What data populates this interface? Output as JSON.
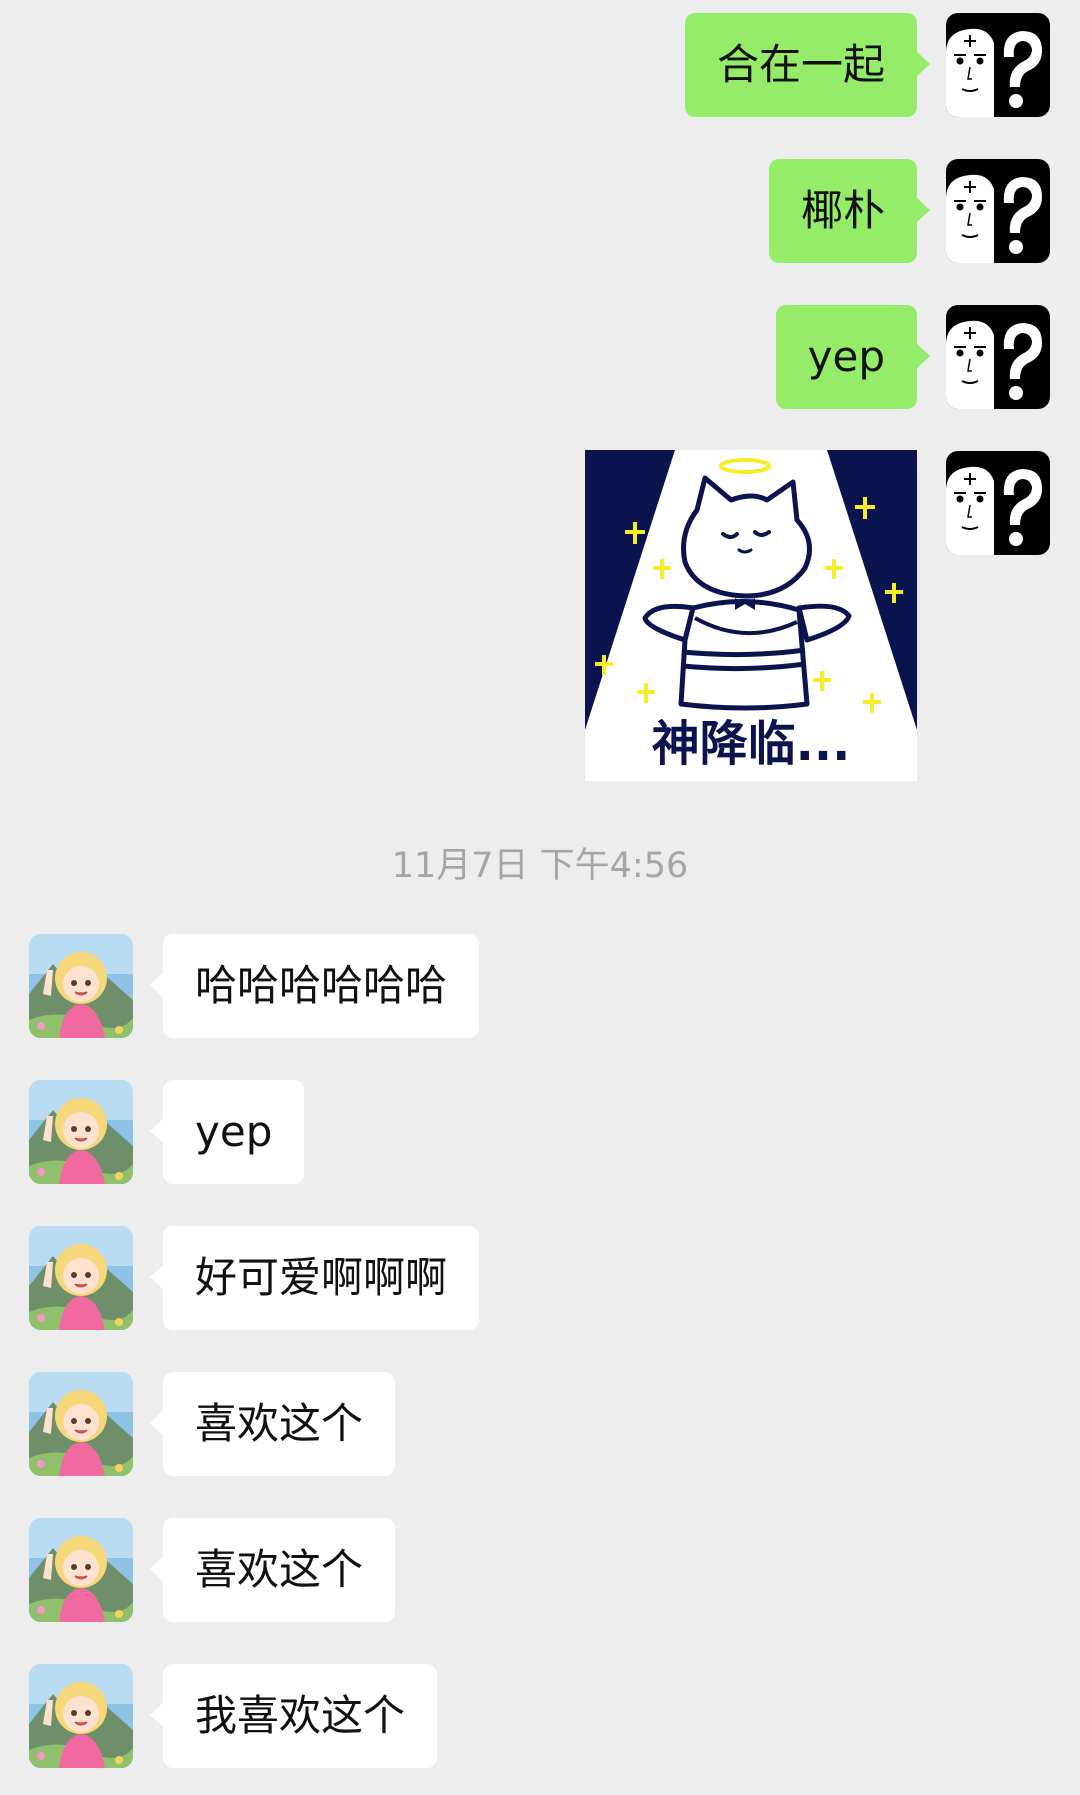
{
  "outgoing_messages": [
    {
      "text": "合在一起"
    },
    {
      "text": "椰朴"
    },
    {
      "text": "yep"
    }
  ],
  "sticker": {
    "caption": "神降临..."
  },
  "timestamp": "11月7日 下午4:56",
  "incoming_messages": [
    {
      "text": "哈哈哈哈哈哈"
    },
    {
      "text": "yep"
    },
    {
      "text": "好可爱啊啊啊"
    },
    {
      "text": "喜欢这个"
    },
    {
      "text": "喜欢这个"
    },
    {
      "text": "我喜欢这个"
    }
  ],
  "colors": {
    "background": "#ededed",
    "outgoing_bubble": "#95ec69",
    "incoming_bubble": "#ffffff",
    "timestamp_text": "#a5a5a5"
  },
  "icons": {
    "my_avatar": "question-mark-face-avatar",
    "friend_avatar": "anime-girl-avatar",
    "sticker": "angel-cat-sticker"
  }
}
